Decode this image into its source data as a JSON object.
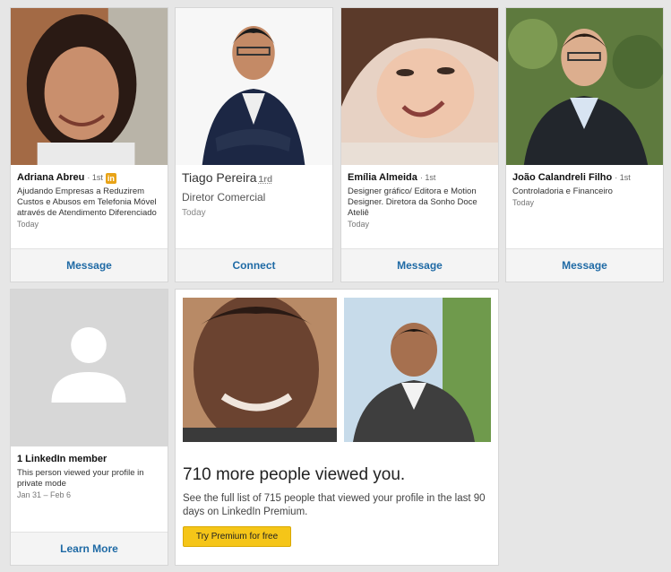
{
  "viewers": [
    {
      "name": "Adriana Abreu",
      "degree": "1st",
      "headline": "Ajudando Empresas a Reduzirem Custos e Abusos em Telefonia Móvel através de Atendimento Diferenciado",
      "when": "Today",
      "action": "Message"
    },
    {
      "name": "Tiago Pereira",
      "degree": "1rd",
      "headline": "Diretor Comercial",
      "when": "Today",
      "action": "Connect"
    },
    {
      "name": "Emília Almeida",
      "degree": "1st",
      "headline": "Designer gráfico/ Editora e Motion Designer. Diretora da Sonho Doce Ateliê",
      "when": "Today",
      "action": "Message"
    },
    {
      "name": "João Calandreli Filho",
      "degree": "1st",
      "headline": "Controladoria e Financeiro",
      "when": "Today",
      "action": "Message"
    }
  ],
  "private_viewer": {
    "title": "1 LinkedIn member",
    "headline": "This person viewed your profile in private mode",
    "when": "Jan 31 – Feb 6",
    "action": "Learn More"
  },
  "premium": {
    "title": "710 more people viewed you.",
    "description": "See the full list of 715 people that viewed your profile in the last 90 days on LinkedIn Premium.",
    "button": "Try Premium for free"
  },
  "badges": {
    "linkedin_icon": "in"
  }
}
